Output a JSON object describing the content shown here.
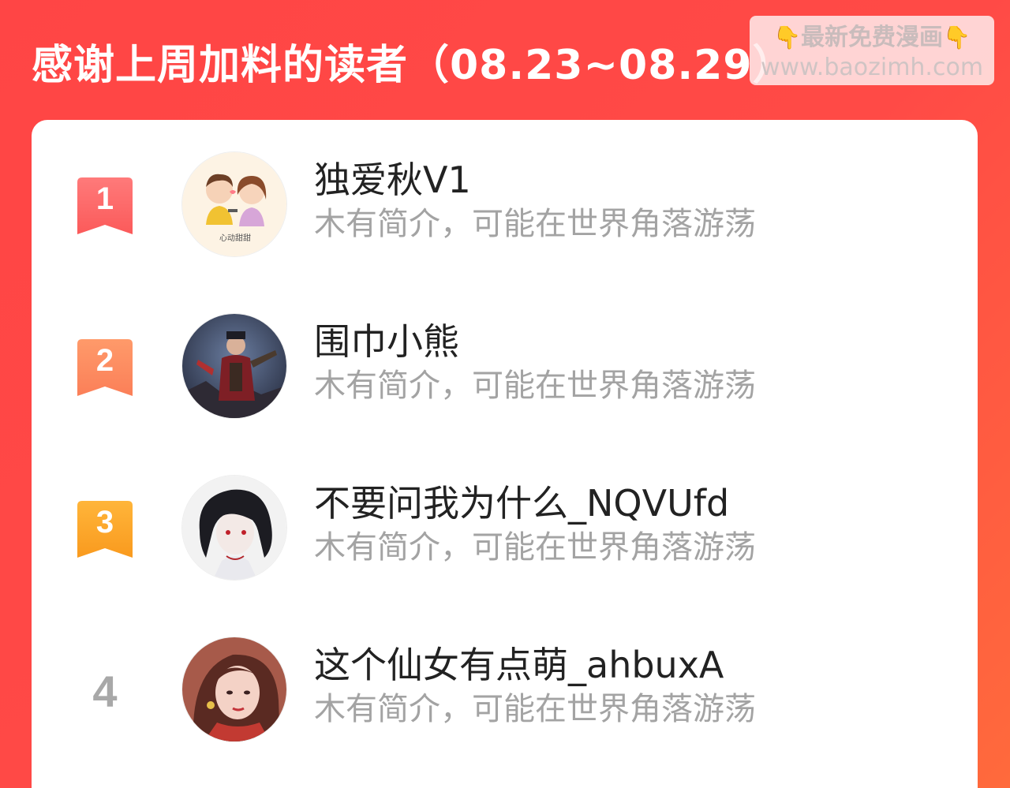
{
  "header": {
    "title": "感谢上周加料的读者（08.23~08.29）"
  },
  "watermark": {
    "line1": "最新免费漫画",
    "line2": "www.baozimh.com",
    "hand_icon": "👇"
  },
  "readers": [
    {
      "rank": "1",
      "name": "独爱秋V1",
      "bio": "木有简介，可能在世界角落游荡",
      "badge_color": "#fd6a6a",
      "avatar_label": "心动甜甜"
    },
    {
      "rank": "2",
      "name": "围巾小熊",
      "bio": "木有简介，可能在世界角落游荡",
      "badge_color": "#fc8a5f"
    },
    {
      "rank": "3",
      "name": "不要问我为什么_NQVUfd",
      "bio": "木有简介，可能在世界角落游荡",
      "badge_color": "#f8a42b"
    },
    {
      "rank": "4",
      "name": "这个仙女有点萌_ahbuxA",
      "bio": "木有简介，可能在世界角落游荡"
    }
  ],
  "colors": {
    "background": "#ff4848",
    "card": "#ffffff",
    "name_text": "#222222",
    "bio_text": "#a3a3a3",
    "rank_plain": "#a8a8a8"
  }
}
